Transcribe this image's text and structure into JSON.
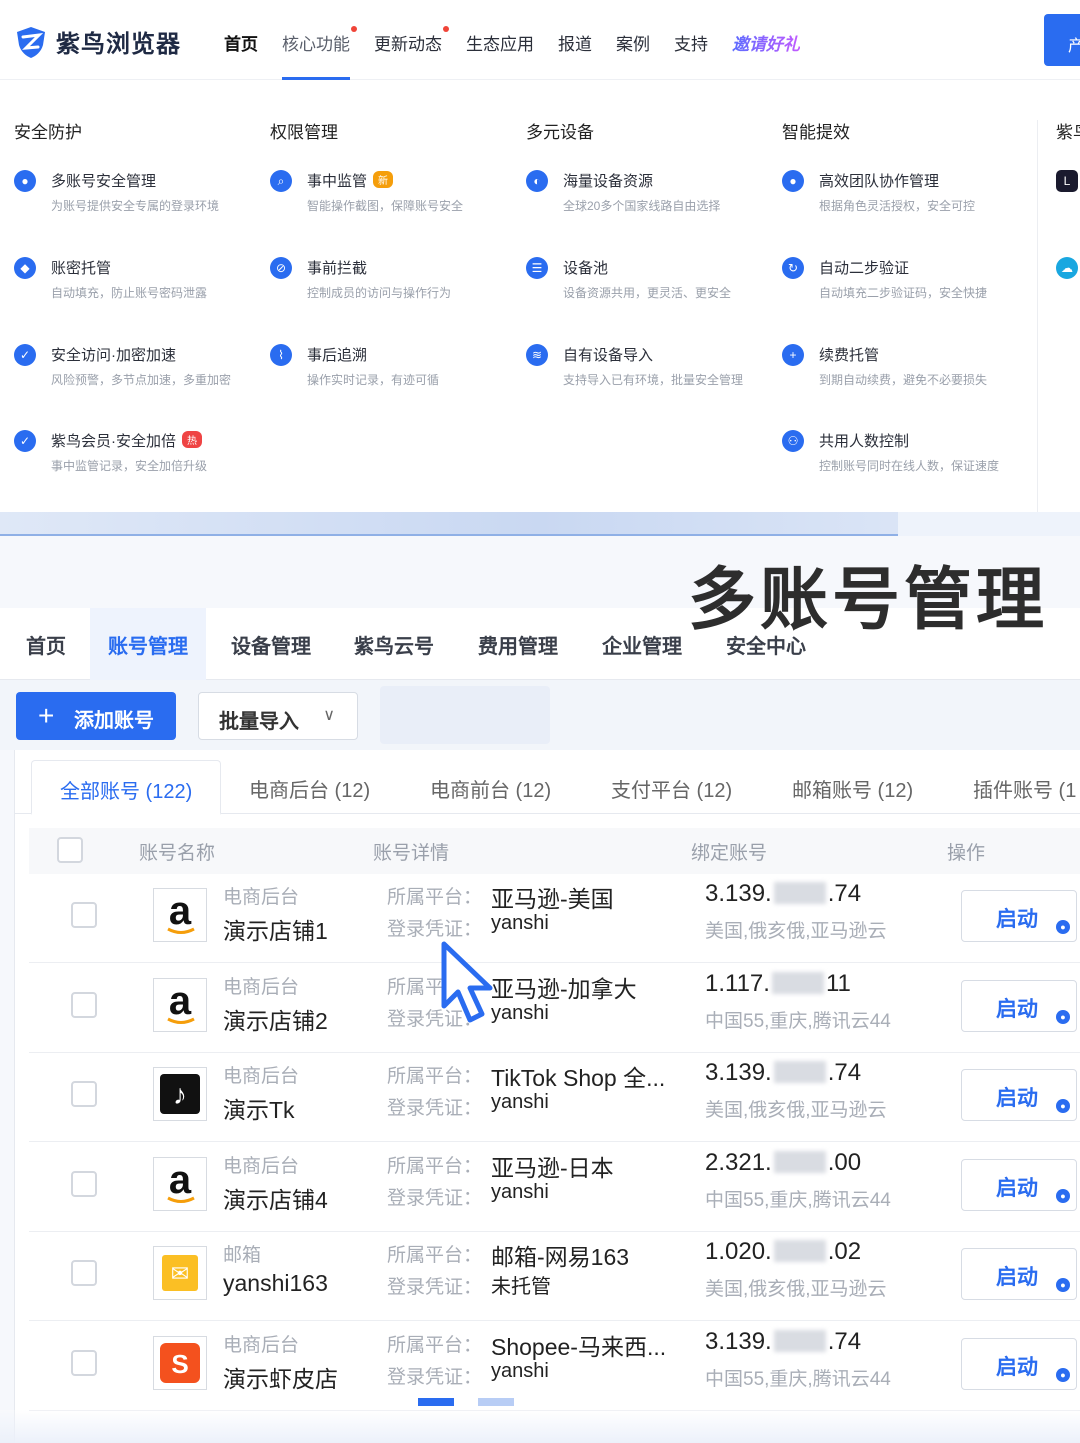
{
  "brand": {
    "name": "紫鸟浏览器"
  },
  "nav": [
    {
      "label": "首页",
      "state": "active",
      "dot": false
    },
    {
      "label": "核心功能",
      "state": "open",
      "dot": true
    },
    {
      "label": "更新动态",
      "state": "",
      "dot": true
    },
    {
      "label": "生态应用",
      "state": "",
      "dot": false
    },
    {
      "label": "报道",
      "state": "",
      "dot": false
    },
    {
      "label": "案例",
      "state": "",
      "dot": false
    },
    {
      "label": "支持",
      "state": "",
      "dot": false
    },
    {
      "label": "邀请好礼",
      "state": "invite",
      "dot": false
    }
  ],
  "cta": {
    "label": "产"
  },
  "mega": {
    "columns": [
      {
        "title": "安全防护",
        "items": [
          {
            "icon": "user-shield-icon",
            "title": "多账号安全管理",
            "desc": "为账号提供安全专属的登录环境"
          },
          {
            "icon": "key-shield-icon",
            "title": "账密托管",
            "desc": "自动填充，防止账号密码泄露"
          },
          {
            "icon": "shield-check-icon",
            "title": "安全访问·加密加速",
            "desc": "风险预警，多节点加速，多重加密"
          },
          {
            "icon": "crown-check-icon",
            "title": "紫鸟会员·安全加倍",
            "desc": "事中监管记录，安全加倍升级",
            "badge": "热",
            "badge_type": "hot"
          }
        ]
      },
      {
        "title": "权限管理",
        "items": [
          {
            "icon": "search-shield-icon",
            "title": "事中监管",
            "desc": "智能操作截图，保障账号安全",
            "badge": "新",
            "badge_type": "new"
          },
          {
            "icon": "block-icon",
            "title": "事前拦截",
            "desc": "控制成员的访问与操作行为"
          },
          {
            "icon": "trace-chart-icon",
            "title": "事后追溯",
            "desc": "操作实时记录，有迹可循"
          }
        ]
      },
      {
        "title": "多元设备",
        "items": [
          {
            "icon": "globe-icon",
            "title": "海量设备资源",
            "desc": "全球20多个国家线路自由选择"
          },
          {
            "icon": "server-icon",
            "title": "设备池",
            "desc": "设备资源共用，更灵活、更安全"
          },
          {
            "icon": "router-icon",
            "title": "自有设备导入",
            "desc": "支持导入已有环境，批量安全管理"
          }
        ]
      },
      {
        "title": "智能提效",
        "items": [
          {
            "icon": "team-icon",
            "title": "高效团队协作管理",
            "desc": "根据角色灵活授权，安全可控"
          },
          {
            "icon": "refresh-verify-icon",
            "title": "自动二步验证",
            "desc": "自动填充二步验证码，安全快捷"
          },
          {
            "icon": "plus-circle-icon",
            "title": "续费托管",
            "desc": "到期自动续费，避免不必要损失"
          },
          {
            "icon": "shared-users-icon",
            "title": "共用人数控制",
            "desc": "控制账号同时在线人数，保证速度"
          }
        ]
      },
      {
        "title": "紫鸟",
        "items": [
          {
            "icon": "linkfox-app-icon",
            "title": "",
            "desc": ""
          },
          {
            "icon": "cloud-app-icon",
            "title": "",
            "desc": ""
          }
        ]
      }
    ]
  },
  "headline": "多账号管理",
  "app_tabs": [
    "首页",
    "账号管理",
    "设备管理",
    "紫鸟云号",
    "费用管理",
    "企业管理",
    "安全中心"
  ],
  "app_tab_active": 1,
  "toolbar": {
    "add_label": "添加账号",
    "import_label": "批量导入"
  },
  "categories": [
    {
      "label": "全部账号 (122)",
      "active": true
    },
    {
      "label": "电商后台 (12)",
      "active": false
    },
    {
      "label": "电商前台 (12)",
      "active": false
    },
    {
      "label": "支付平台 (12)",
      "active": false
    },
    {
      "label": "邮箱账号 (12)",
      "active": false
    },
    {
      "label": "插件账号 (1",
      "active": false
    }
  ],
  "table": {
    "headers": {
      "name": "账号名称",
      "detail": "账号详情",
      "bound": "绑定账号",
      "action": "操作"
    },
    "platform_key": "所属平台：",
    "cred_key": "登录凭证：",
    "rows": [
      {
        "logo": "amazon",
        "category": "电商后台",
        "store": "演示店铺1",
        "platform": "亚马逊-美国",
        "cred": "yanshi",
        "ip_a": "3.139.",
        "ip_b": ".74",
        "location": "美国,俄亥俄,亚马逊云",
        "action": "启动"
      },
      {
        "logo": "amazon",
        "category": "电商后台",
        "store": "演示店铺2",
        "platform": "亚马逊-加拿大",
        "cred": "yanshi",
        "ip_a": "1.117.",
        "ip_b": "11",
        "location": "中国55,重庆,腾讯云44",
        "action": "启动"
      },
      {
        "logo": "tiktok",
        "category": "电商后台",
        "store": "演示Tk",
        "platform": "TikTok Shop 全...",
        "cred": "yanshi",
        "ip_a": "3.139.",
        "ip_b": ".74",
        "location": "美国,俄亥俄,亚马逊云",
        "action": "启动"
      },
      {
        "logo": "amazon",
        "category": "电商后台",
        "store": "演示店铺4",
        "platform": "亚马逊-日本",
        "cred": "yanshi",
        "ip_a": "2.321.",
        "ip_b": ".00",
        "location": "中国55,重庆,腾讯云44",
        "action": "启动"
      },
      {
        "logo": "mail",
        "category": "邮箱",
        "store": "yanshi163",
        "platform": "邮箱-网易163",
        "cred": "未托管",
        "ip_a": "1.020.",
        "ip_b": ".02",
        "location": "美国,俄亥俄,亚马逊云",
        "action": "启动"
      },
      {
        "logo": "shopee",
        "category": "电商后台",
        "store": "演示虾皮店",
        "platform": "Shopee-马来西...",
        "cred": "yanshi",
        "ip_a": "3.139.",
        "ip_b": ".74",
        "location": "中国55,重庆,腾讯云44",
        "action": "启动"
      }
    ]
  },
  "colors": {
    "primary": "#2a6cf0",
    "hot": "#ef4444",
    "new": "#f59e0b"
  }
}
